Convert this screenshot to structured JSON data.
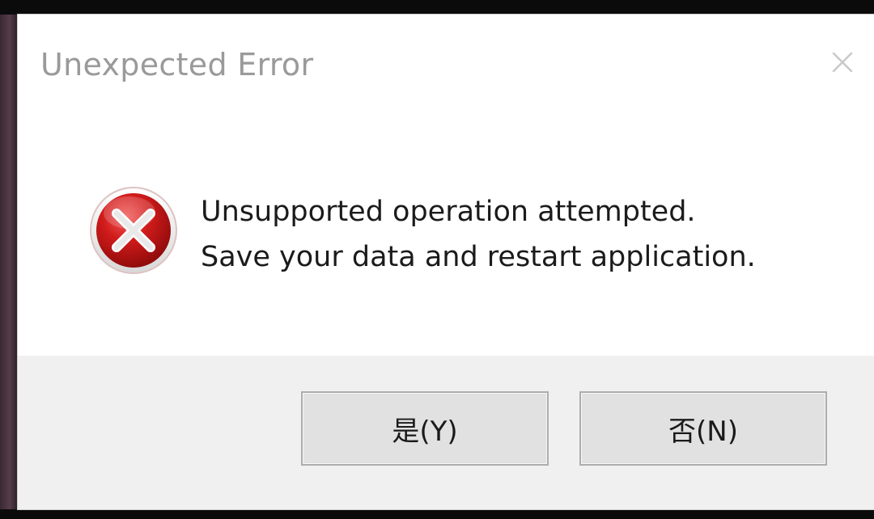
{
  "dialog": {
    "title": "Unexpected Error",
    "message_lines": [
      "Unsupported operation attempted.",
      "Save your data and restart application."
    ],
    "icons": {
      "status": "error-x-icon",
      "close": "close-icon"
    },
    "buttons": {
      "yes_label": "是(Y)",
      "no_label": "否(N)"
    },
    "colors": {
      "error_red": "#c1121f",
      "title_text": "#9a9a9a",
      "body_text": "#1b1b1b",
      "footer_bg": "#f0f0f0",
      "button_bg": "#e1e1e1"
    }
  }
}
